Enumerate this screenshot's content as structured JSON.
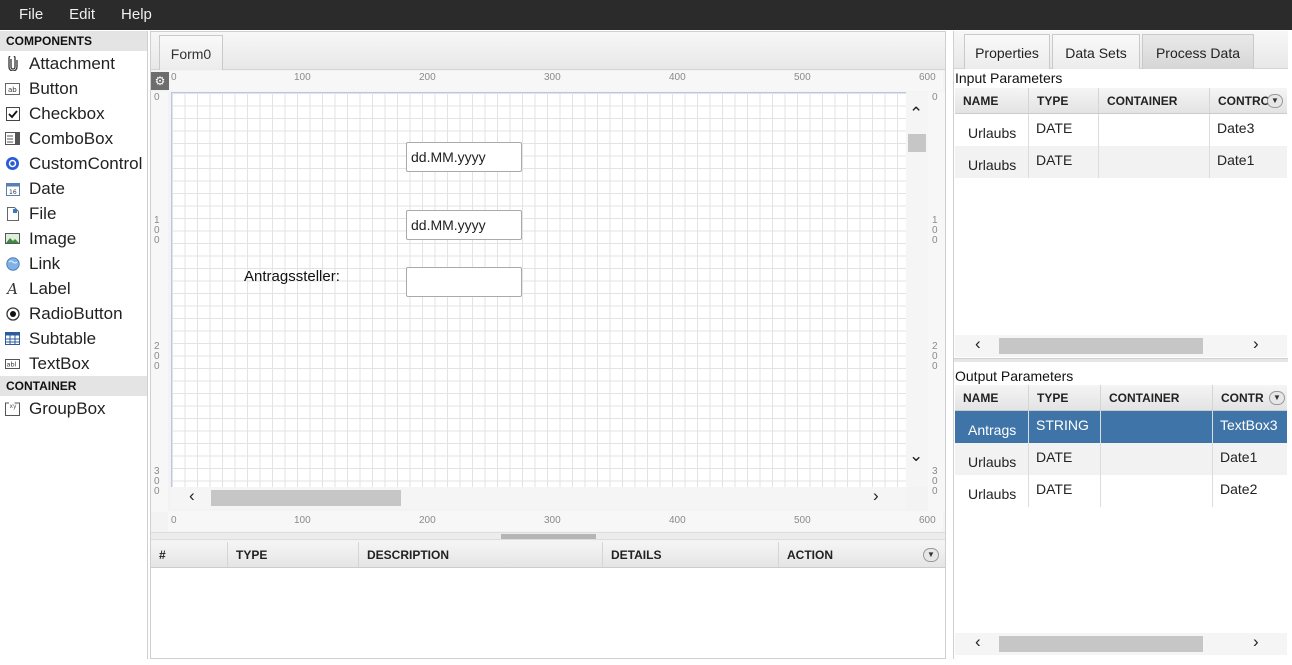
{
  "menu": {
    "file": "File",
    "edit": "Edit",
    "help": "Help"
  },
  "sidebar": {
    "components_header": "COMPONENTS",
    "components": [
      {
        "label": "Attachment",
        "icon": "paperclip-icon"
      },
      {
        "label": "Button",
        "icon": "button-icon"
      },
      {
        "label": "Checkbox",
        "icon": "checkbox-icon"
      },
      {
        "label": "ComboBox",
        "icon": "combobox-icon"
      },
      {
        "label": "CustomControl",
        "icon": "custom-control-icon"
      },
      {
        "label": "Date",
        "icon": "calendar-icon"
      },
      {
        "label": "File",
        "icon": "file-icon"
      },
      {
        "label": "Image",
        "icon": "image-icon"
      },
      {
        "label": "Link",
        "icon": "globe-icon"
      },
      {
        "label": "Label",
        "icon": "label-icon"
      },
      {
        "label": "RadioButton",
        "icon": "radio-icon"
      },
      {
        "label": "Subtable",
        "icon": "table-icon"
      },
      {
        "label": "TextBox",
        "icon": "textbox-icon"
      }
    ],
    "container_header": "CONTAINER",
    "containers": [
      {
        "label": "GroupBox",
        "icon": "groupbox-icon"
      }
    ]
  },
  "editor": {
    "tab": "Form0",
    "ruler": {
      "h_labels": [
        "0",
        "100",
        "200",
        "300",
        "400",
        "500",
        "600"
      ],
      "v_labels": [
        "0",
        "100",
        "200",
        "300"
      ]
    },
    "fields": [
      {
        "placeholder": "dd.MM.yyyy"
      },
      {
        "placeholder": "dd.MM.yyyy"
      },
      {
        "placeholder": ""
      }
    ],
    "label_antragssteller": "Antragssteller:"
  },
  "messages": {
    "columns": [
      "#",
      "TYPE",
      "DESCRIPTION",
      "DETAILS",
      "ACTION"
    ]
  },
  "right_panel": {
    "tabs": [
      "Properties",
      "Data Sets",
      "Process Data"
    ],
    "active_tab": "Process Data",
    "input": {
      "title": "Input Parameters",
      "columns": [
        "NAME",
        "TYPE",
        "CONTAINER",
        "CONTRO"
      ],
      "rows": [
        {
          "name": "Urlaubs",
          "type": "DATE",
          "container": "",
          "control": "Date3"
        },
        {
          "name": "Urlaubs",
          "type": "DATE",
          "container": "",
          "control": "Date1"
        }
      ]
    },
    "output": {
      "title": "Output Parameters",
      "columns": [
        "NAME",
        "TYPE",
        "CONTAINER",
        "CONTR"
      ],
      "rows": [
        {
          "name": "Antrags",
          "type": "STRING",
          "container": "",
          "control": "TextBox3",
          "selected": true
        },
        {
          "name": "Urlaubs",
          "type": "DATE",
          "container": "",
          "control": "Date1"
        },
        {
          "name": "Urlaubs",
          "type": "DATE",
          "container": "",
          "control": "Date2"
        }
      ]
    }
  },
  "colors": {
    "menubar": "#2b2b2b",
    "selection": "#3f74a8"
  }
}
